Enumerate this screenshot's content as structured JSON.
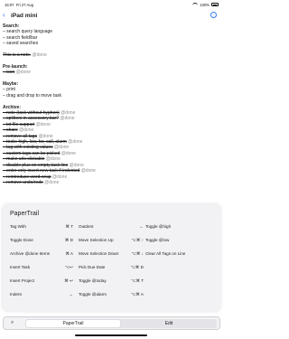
{
  "status": {
    "time": "16:07",
    "date": "Fri 27 Aug",
    "battery": "100%"
  },
  "nav": {
    "back": "‹",
    "title": "iPad mini",
    "more": "···"
  },
  "document": [
    {
      "text": "Search:",
      "kind": "heading"
    },
    {
      "text": "– search query language",
      "kind": "item"
    },
    {
      "text": "– search field/bar",
      "kind": "item"
    },
    {
      "text": "– saved searches",
      "kind": "item"
    },
    {
      "text": "",
      "kind": "gap"
    },
    {
      "text": "This is a note.",
      "tag": "@done",
      "kind": "done"
    },
    {
      "text": "",
      "kind": "gap"
    },
    {
      "text": "Pre-launch:",
      "kind": "heading"
    },
    {
      "text": "– icon",
      "tag": "@done",
      "kind": "done"
    },
    {
      "text": "",
      "kind": "gap"
    },
    {
      "text": "Maybe:",
      "kind": "heading"
    },
    {
      "text": "– print",
      "kind": "item"
    },
    {
      "text": "– drag and drop to move task",
      "kind": "item"
    },
    {
      "text": "",
      "kind": "gap"
    },
    {
      "text": "Archive:",
      "kind": "heading"
    },
    {
      "text": "– note (task without hyphen)",
      "tag": "@done",
      "kind": "done"
    },
    {
      "text": "– splitters in accessory bar?",
      "tag": "@done",
      "kind": "done"
    },
    {
      "text": "– txt file support",
      "tag": "@done",
      "kind": "done"
    },
    {
      "text": "– share",
      "tag": "@done",
      "kind": "done"
    },
    {
      "text": "– remove all tags",
      "tag": "@done",
      "kind": "done"
    },
    {
      "text": "– tools: high, low, for, call, alarm",
      "tag": "@done",
      "kind": "done"
    },
    {
      "text": "– tag with existing values",
      "tag": "@done",
      "kind": "done"
    },
    {
      "text": "– custom tags can be picked",
      "tag": "@done",
      "kind": "done"
    },
    {
      "text": "– make urls clickable",
      "tag": "@done",
      "kind": "done"
    },
    {
      "text": "– disable plus on empty task line",
      "tag": "@done",
      "kind": "done"
    },
    {
      "text": "– enter only insert new task if indented",
      "tag": "@done",
      "kind": "done"
    },
    {
      "text": "– reintroduce word wrap",
      "tag": "@done",
      "kind": "done"
    },
    {
      "text": "– remove undo/redo",
      "tag": "@done",
      "kind": "done"
    }
  ],
  "panel": {
    "title": "PaperTrail",
    "columns": [
      [
        {
          "label": "Tag With",
          "key": "⌘ T"
        },
        {
          "label": "Toggle Done",
          "key": "⌘ D"
        },
        {
          "label": "Archive @done Items",
          "key": "⌘ A"
        },
        {
          "label": "Insert Task",
          "key": "⌥↩"
        },
        {
          "label": "Insert Project",
          "key": "⌘ ↩"
        },
        {
          "label": "Indent",
          "key": "→"
        }
      ],
      [
        {
          "label": "Outdent",
          "key": "←"
        },
        {
          "label": "Move Selection Up",
          "key": "⌥⌘ ↑"
        },
        {
          "label": "Move Selection Down",
          "key": "⌥⌘ ↓"
        },
        {
          "label": "Pick Due Date",
          "key": "⌥⌘ D"
        },
        {
          "label": "Toggle @today",
          "key": "⌥⌘ T"
        },
        {
          "label": "Toggle @alarm",
          "key": "⌥⌘ A"
        }
      ],
      [
        {
          "label": "Toggle @high",
          "key": ""
        },
        {
          "label": "Toggle @low",
          "key": ""
        },
        {
          "label": "Clear All Tags on Line",
          "key": ""
        },
        {
          "label": "",
          "key": ""
        },
        {
          "label": "",
          "key": ""
        },
        {
          "label": "",
          "key": ""
        }
      ]
    ],
    "icons": [
      "→",
      "⇥",
      "☰"
    ]
  },
  "toolbar": {
    "search_icon": "⌕",
    "segment_active": "PaperTrail",
    "segment_other": "Edit"
  }
}
